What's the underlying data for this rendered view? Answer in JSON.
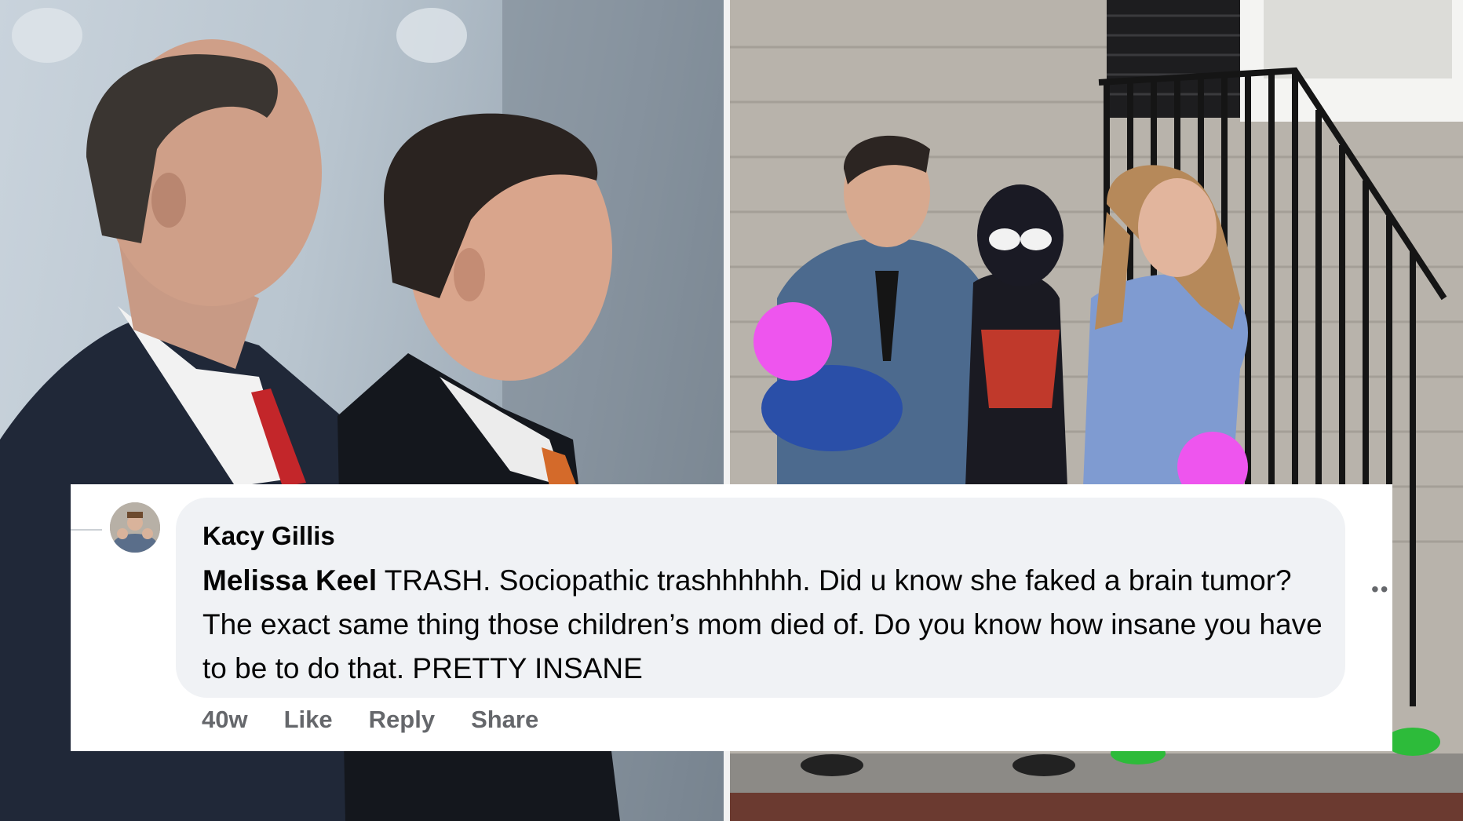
{
  "comment": {
    "author": "Kacy Gillis",
    "mention": "Melissa Keel",
    "text": " TRASH. Sociopathic trashhhhhh. Did u know she faked a brain tumor? The exact same thing those children’s mom died of. Do you know how insane you have to be to do that. PRETTY INSANE",
    "time": "40w",
    "like_label": "Like",
    "reply_label": "Reply",
    "share_label": "Share",
    "more_icon": "more-dots-icon"
  },
  "colors": {
    "bubble_bg": "#f0f2f5",
    "text": "#050505",
    "muted": "#65676b",
    "blur_patch": "#ee55ee"
  }
}
